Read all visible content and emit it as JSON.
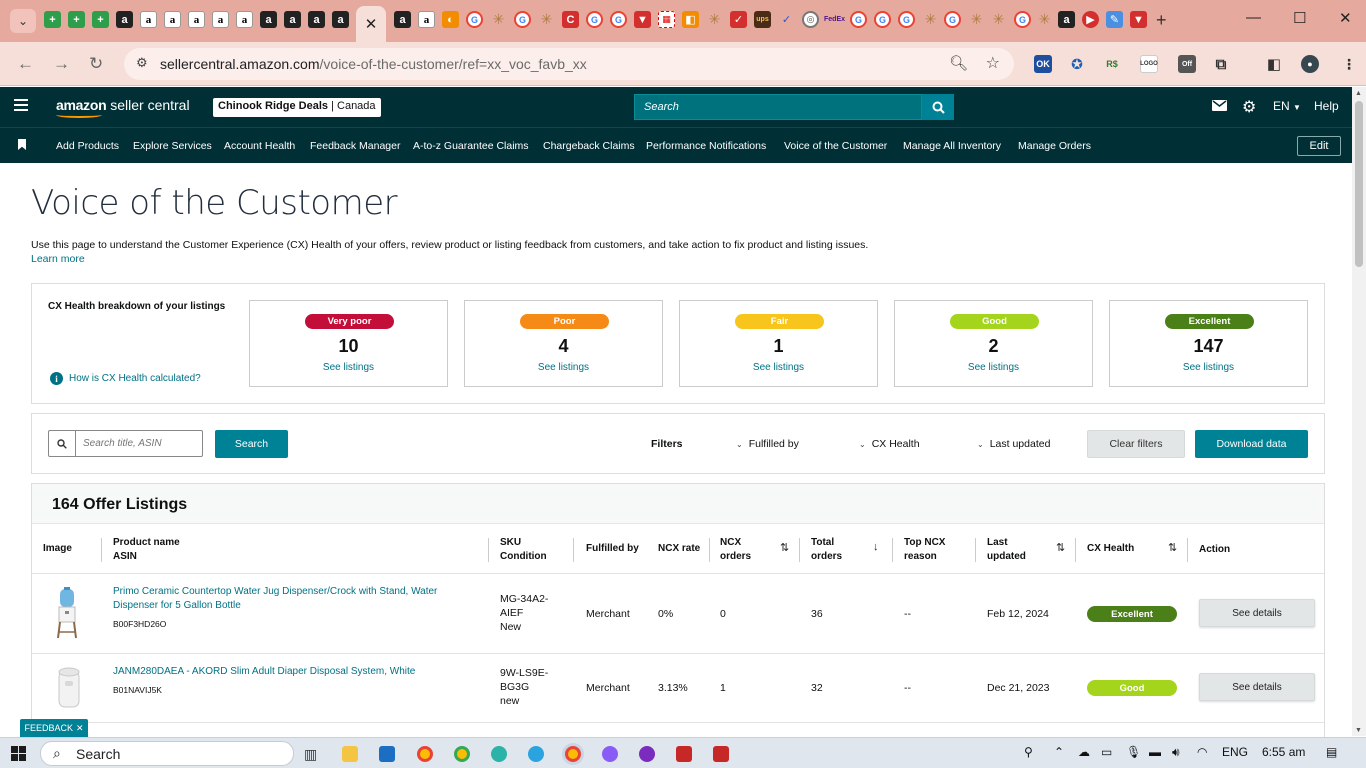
{
  "browser": {
    "url_domain": "sellercentral.amazon.com",
    "url_path": "/voice-of-the-customer/ref=xx_voc_favb_xx",
    "active_tab_close": "✕",
    "new_tab": "+"
  },
  "header": {
    "logo_amazon": "amazon",
    "logo_suffix": " seller central",
    "store_name": "Chinook Ridge Deals",
    "store_region": " | Canada",
    "search_placeholder": "Search",
    "language": "EN",
    "help": "Help"
  },
  "shortcuts": {
    "links": [
      "Add Products",
      "Explore Services",
      "Account Health",
      "Feedback Manager",
      "A-to-z Guarantee Claims",
      "Chargeback Claims",
      "Performance Notifications",
      "Voice of the Customer",
      "Manage All Inventory",
      "Manage Orders"
    ],
    "edit": "Edit"
  },
  "page": {
    "title": "Voice of the Customer",
    "description": "Use this page to understand the Customer Experience (CX) Health of your offers, review product or listing feedback from customers, and take action to fix product and listing issues.",
    "learn_more": "Learn more"
  },
  "health": {
    "label": "CX Health breakdown of your listings",
    "how_calculated": "How is CX Health calculated?",
    "cards": [
      {
        "badge": "Very poor",
        "count": "10",
        "link": "See listings",
        "color": "#c40e3a",
        "text_color": "#ffffff"
      },
      {
        "badge": "Poor",
        "count": "4",
        "link": "See listings",
        "color": "#f58a16",
        "text_color": "#ffffff"
      },
      {
        "badge": "Fair",
        "count": "1",
        "link": "See listings",
        "color": "#f7c51b",
        "text_color": "#ffffff"
      },
      {
        "badge": "Good",
        "count": "2",
        "link": "See listings",
        "color": "#a5d41c",
        "text_color": "#ffffff"
      },
      {
        "badge": "Excellent",
        "count": "147",
        "link": "See listings",
        "color": "#4b7f18",
        "text_color": "#ffffff"
      }
    ]
  },
  "filters": {
    "search_placeholder": "Search title, ASIN",
    "search_button": "Search",
    "label": "Filters",
    "fulfilled_by": "Fulfilled by",
    "cx_health": "CX Health",
    "last_updated": "Last updated",
    "clear": "Clear filters",
    "download": "Download data"
  },
  "listings": {
    "title": "164 Offer Listings",
    "columns": {
      "image": "Image",
      "product_name": "Product name",
      "asin": "ASIN",
      "sku": "SKU",
      "condition": "Condition",
      "fulfilled_by": "Fulfilled by",
      "ncx_rate": "NCX rate",
      "ncx_orders_1": "NCX",
      "ncx_orders_2": "orders",
      "total_orders_1": "Total",
      "total_orders_2": "orders",
      "top_ncx_1": "Top NCX",
      "top_ncx_2": "reason",
      "last_updated_1": "Last",
      "last_updated_2": "updated",
      "cx_health": "CX Health",
      "action": "Action"
    },
    "rows": [
      {
        "name_line1": "Primo Ceramic Countertop Water Jug Dispenser/Crock with Stand, Water",
        "name_line2": "Dispenser for 5 Gallon Bottle",
        "asin": "B00F3HD26O",
        "sku_line1": "MG-34A2-",
        "sku_line2": "AIEF",
        "condition": "New",
        "fulfilled_by": "Merchant",
        "ncx_rate": "0%",
        "ncx_orders": "0",
        "total_orders": "36",
        "top_ncx": "--",
        "last_updated": "Feb 12, 2024",
        "cx_health": "Excellent",
        "cx_color": "#4b7f18",
        "action": "See details"
      },
      {
        "name_line1": "JANM280DAEA - AKORD Slim Adult Diaper Disposal System, White",
        "name_line2": "",
        "asin": "B01NAVIJ5K",
        "sku_line1": "9W-LS9E-",
        "sku_line2": "BG3G",
        "condition": "new",
        "fulfilled_by": "Merchant",
        "ncx_rate": "3.13%",
        "ncx_orders": "1",
        "total_orders": "32",
        "top_ncx": "--",
        "last_updated": "Dec 21, 2023",
        "cx_health": "Good",
        "cx_color": "#a5d41c",
        "action": "See details"
      }
    ]
  },
  "feedback": "FEEDBACK",
  "taskbar": {
    "search": "Search",
    "language": "ENG",
    "time": "6:55 am"
  }
}
